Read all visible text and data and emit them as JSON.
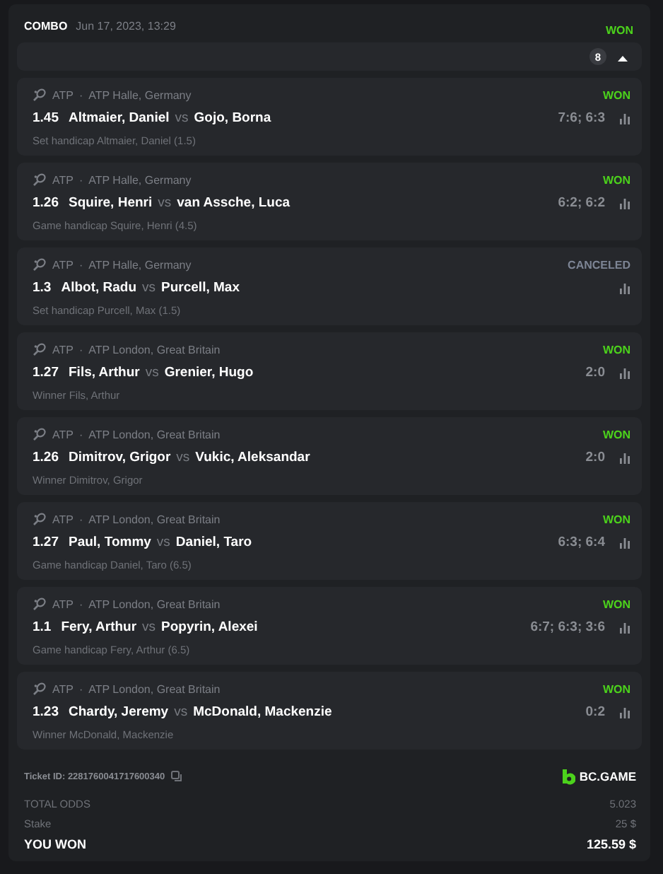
{
  "header": {
    "type": "COMBO",
    "date": "Jun 17, 2023, 13:29",
    "status": "WON",
    "color": "#4cd21c"
  },
  "collapse_bar": {
    "count": "8",
    "expanded": true
  },
  "bets": [
    {
      "sport": "ATP",
      "separator": "·",
      "tournament": "ATP Halle, Germany",
      "status": "WON",
      "color": "#4cd21c",
      "odds": "1.45",
      "home": "Altmaier, Daniel",
      "vs": "vs",
      "away": "Gojo, Borna",
      "score": "7:6; 6:3",
      "market": "Set handicap Altmaier, Daniel (1.5)"
    },
    {
      "sport": "ATP",
      "separator": "·",
      "tournament": "ATP Halle, Germany",
      "status": "WON",
      "color": "#4cd21c",
      "odds": "1.26",
      "home": "Squire, Henri",
      "vs": "vs",
      "away": "van Assche, Luca",
      "score": "6:2; 6:2",
      "market": "Game handicap Squire, Henri (4.5)"
    },
    {
      "sport": "ATP",
      "separator": "·",
      "tournament": "ATP Halle, Germany",
      "status": "CANCELED",
      "color": "#7d8595",
      "odds": "1.3",
      "home": "Albot, Radu",
      "vs": "vs",
      "away": "Purcell, Max",
      "market": "Set handicap Purcell, Max (1.5)"
    },
    {
      "sport": "ATP",
      "separator": "·",
      "tournament": "ATP London, Great Britain",
      "status": "WON",
      "color": "#4cd21c",
      "odds": "1.27",
      "home": "Fils, Arthur",
      "vs": "vs",
      "away": "Grenier, Hugo",
      "score": "2:0",
      "market": "Winner Fils, Arthur"
    },
    {
      "sport": "ATP",
      "separator": "·",
      "tournament": "ATP London, Great Britain",
      "status": "WON",
      "color": "#4cd21c",
      "odds": "1.26",
      "home": "Dimitrov, Grigor",
      "vs": "vs",
      "away": "Vukic, Aleksandar",
      "score": "2:0",
      "market": "Winner Dimitrov, Grigor"
    },
    {
      "sport": "ATP",
      "separator": "·",
      "tournament": "ATP London, Great Britain",
      "status": "WON",
      "color": "#4cd21c",
      "odds": "1.27",
      "home": "Paul, Tommy",
      "vs": "vs",
      "away": "Daniel, Taro",
      "score": "6:3; 6:4",
      "market": "Game handicap Daniel, Taro (6.5)"
    },
    {
      "sport": "ATP",
      "separator": "·",
      "tournament": "ATP London, Great Britain",
      "status": "WON",
      "color": "#4cd21c",
      "odds": "1.1",
      "home": "Fery, Arthur",
      "vs": "vs",
      "away": "Popyrin, Alexei",
      "score": "6:7; 6:3; 3:6",
      "market": "Game handicap Fery, Arthur (6.5)"
    },
    {
      "sport": "ATP",
      "separator": "·",
      "tournament": "ATP London, Great Britain",
      "status": "WON",
      "color": "#4cd21c",
      "odds": "1.23",
      "home": "Chardy, Jeremy",
      "vs": "vs",
      "away": "McDonald, Mackenzie",
      "score": "0:2",
      "market": "Winner McDonald, Mackenzie"
    }
  ],
  "footer": {
    "ticket_id": "Ticket ID: 2281760041717600340",
    "brand": "BC.GAME",
    "totals": [
      {
        "label": "TOTAL ODDS",
        "value": "5.023",
        "kind": "plain"
      },
      {
        "label": "Stake",
        "value": "25 $",
        "kind": "plain"
      },
      {
        "label": "YOU WON",
        "value": "125.59 $",
        "kind": "result"
      }
    ]
  }
}
